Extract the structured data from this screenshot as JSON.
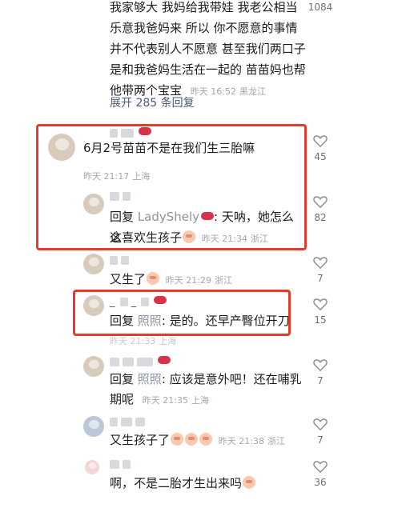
{
  "top_comment": {
    "lines": [
      "我家够大  我妈给我带娃  我老公相当",
      "乐意我爸妈来  所以 你不愿意的事情",
      "并不代表别人不愿意  甚至我们两口子",
      "是和我爸妈生活在一起的  苗苗妈也帮"
    ],
    "last_line": "他带两个宝宝",
    "time": "昨天 16:52",
    "location": "黑龙江",
    "likes": "1084",
    "expand_label": "展开 285 条回复"
  },
  "comments": [
    {
      "name": "_ ▇ ▇",
      "text": "6月2号苗苗不是在我们生三胎嘛",
      "time": "昨天 21:17",
      "location": "上海",
      "likes": "45"
    },
    {
      "name": "▇ ▇",
      "reply_word": "回复",
      "reply_to": "LadyShely",
      "text1": ": 天呐，她怎么这",
      "text2": "么喜欢生孩子",
      "time": "昨天 21:34",
      "location": "浙江",
      "likes": "82"
    },
    {
      "name": "▇ ▇",
      "text": "又生了",
      "time": "昨天 21:29",
      "location": "浙江",
      "likes": "7"
    },
    {
      "name": "_ ▇ _ ▇",
      "reply_word": "回复",
      "reply_to": "照照",
      "text": ": 是的。还早产臀位开刀",
      "time": "昨天 21:33",
      "location": "上海",
      "likes": "15"
    },
    {
      "name": "▇ ▇ ▇",
      "reply_word": "回复",
      "reply_to": "照照",
      "text1": ": 应该是意外吧！还在哺乳",
      "text2": "期呢",
      "time": "昨天 21:35",
      "location": "上海",
      "likes": "7"
    },
    {
      "name": "▇ ▇ ▇",
      "text": "又生孩子了",
      "time": "昨天 21:38",
      "location": "浙江",
      "likes": "7"
    },
    {
      "name": "▇ ▇",
      "text": "啊，不是二胎才生出来吗",
      "likes": "36"
    }
  ],
  "colors": {
    "highlight_box": "#e53b2a",
    "meta": "#a3a6ab",
    "link": "#4b5a7a"
  }
}
